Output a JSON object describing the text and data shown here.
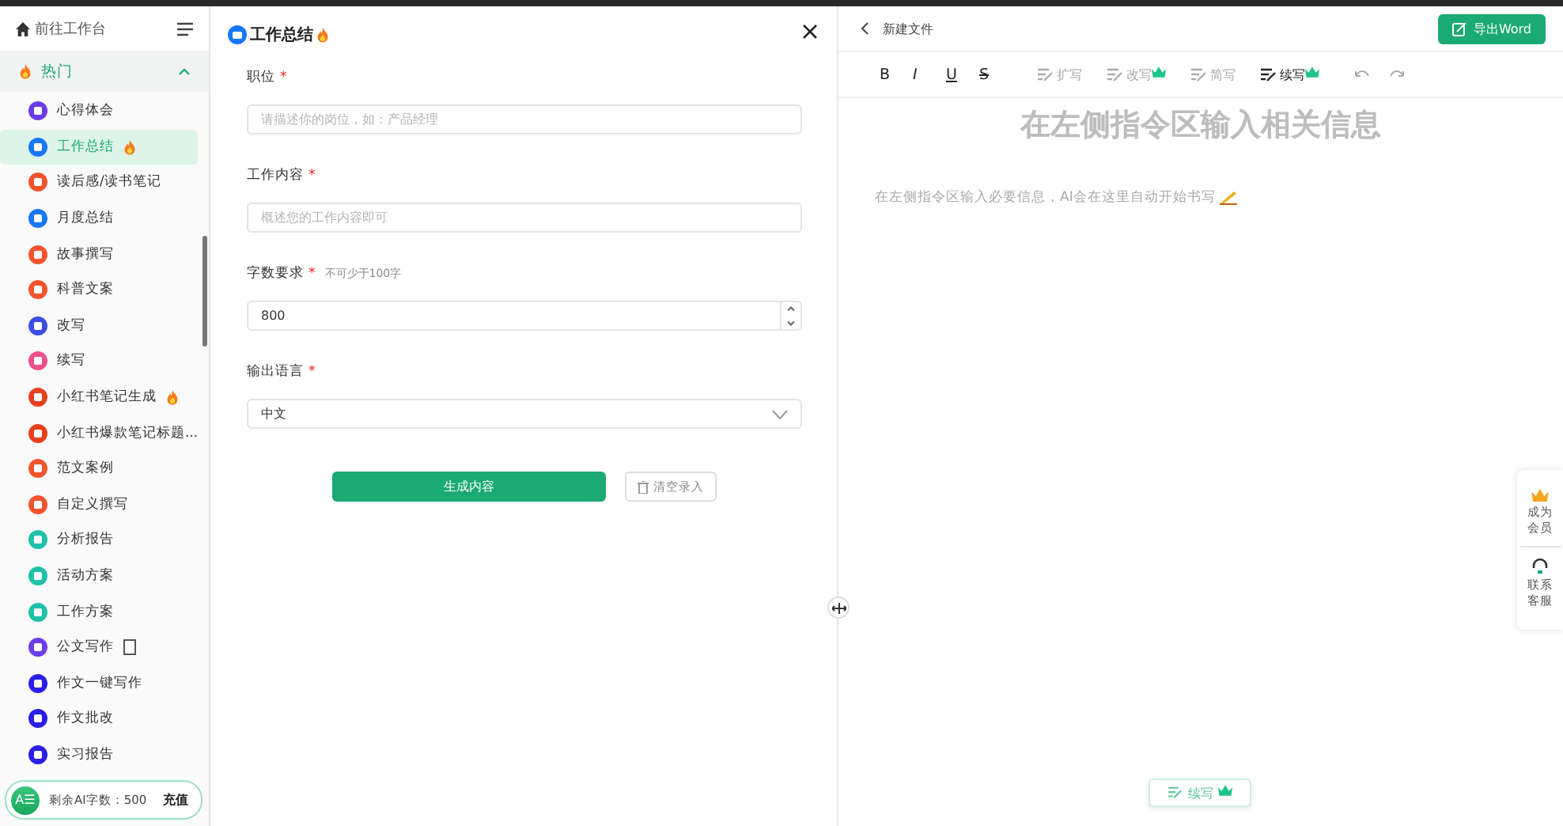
{
  "sidebar": {
    "home_link": "前往工作台",
    "group": {
      "label": "热门",
      "expanded": true
    },
    "items": [
      {
        "label": "心得体会",
        "color": "#6a3de8",
        "selected": false,
        "hot": false,
        "doc": false
      },
      {
        "label": "工作总结",
        "color": "#1677ff",
        "selected": true,
        "hot": true,
        "doc": false
      },
      {
        "label": "读后感/读书笔记",
        "color": "#f5532d",
        "selected": false,
        "hot": false,
        "doc": false
      },
      {
        "label": "月度总结",
        "color": "#1677ff",
        "selected": false,
        "hot": false,
        "doc": false
      },
      {
        "label": "故事撰写",
        "color": "#f5532d",
        "selected": false,
        "hot": false,
        "doc": false
      },
      {
        "label": "科普文案",
        "color": "#f5532d",
        "selected": false,
        "hot": false,
        "doc": false
      },
      {
        "label": "改写",
        "color": "#3d4de8",
        "selected": false,
        "hot": false,
        "doc": false
      },
      {
        "label": "续写",
        "color": "#f0508c",
        "selected": false,
        "hot": false,
        "doc": false
      },
      {
        "label": "小红书笔记生成",
        "color": "#e8401c",
        "selected": false,
        "hot": true,
        "doc": false
      },
      {
        "label": "小红书爆款笔记标题...",
        "color": "#e8401c",
        "selected": false,
        "hot": false,
        "doc": false
      },
      {
        "label": "范文案例",
        "color": "#f5532d",
        "selected": false,
        "hot": false,
        "doc": false
      },
      {
        "label": "自定义撰写",
        "color": "#f5532d",
        "selected": false,
        "hot": false,
        "doc": false
      },
      {
        "label": "分析报告",
        "color": "#1ec2a8",
        "selected": false,
        "hot": false,
        "doc": false
      },
      {
        "label": "活动方案",
        "color": "#1ec2a8",
        "selected": false,
        "hot": false,
        "doc": false
      },
      {
        "label": "工作方案",
        "color": "#1ec2a8",
        "selected": false,
        "hot": false,
        "doc": false
      },
      {
        "label": "公文写作",
        "color": "#6a3de8",
        "selected": false,
        "hot": false,
        "doc": true
      },
      {
        "label": "作文一键写作",
        "color": "#2a1ee8",
        "selected": false,
        "hot": false,
        "doc": false
      },
      {
        "label": "作文批改",
        "color": "#2a1ee8",
        "selected": false,
        "hot": false,
        "doc": false
      },
      {
        "label": "实习报告",
        "color": "#2a1ee8",
        "selected": false,
        "hot": false,
        "doc": false
      }
    ],
    "quota": {
      "avatar": "A☰",
      "label": "剩余AI字数：500",
      "action": "充值"
    }
  },
  "form": {
    "title": "工作总结",
    "hot": true,
    "fields": [
      {
        "kind": "text",
        "label": "职位",
        "required_mark": "*",
        "placeholder": "请描述你的岗位，如：产品经理"
      },
      {
        "kind": "text",
        "label": "工作内容",
        "required_mark": "*",
        "placeholder": "概述您的工作内容即可"
      },
      {
        "kind": "number",
        "label": "字数要求",
        "required_mark": "*",
        "hint": "不可少于100字",
        "value": "800"
      },
      {
        "kind": "select",
        "label": "输出语言",
        "required_mark": "*",
        "value": "中文"
      }
    ],
    "submit": "生成内容",
    "clear": "清空录入"
  },
  "editor": {
    "file_name": "新建文件",
    "export": "导出Word",
    "format_tools": [
      "B",
      "I",
      "U",
      "S"
    ],
    "ai_tools": [
      {
        "label": "扩写",
        "disabled": true,
        "premium": false
      },
      {
        "label": "改写",
        "disabled": true,
        "premium": true
      },
      {
        "label": "简写",
        "disabled": true,
        "premium": false
      },
      {
        "label": "续写",
        "disabled": false,
        "premium": true
      }
    ],
    "heading": "在左侧指令区输入相关信息",
    "placeholder": "在左侧指令区输入必要信息，AI会在这里自动开始书写",
    "float_tool": {
      "label": "续写",
      "premium": true
    }
  },
  "side_panel": [
    {
      "kind": "vip",
      "label": "成为会员"
    },
    {
      "kind": "service",
      "label": "联系客服"
    }
  ]
}
